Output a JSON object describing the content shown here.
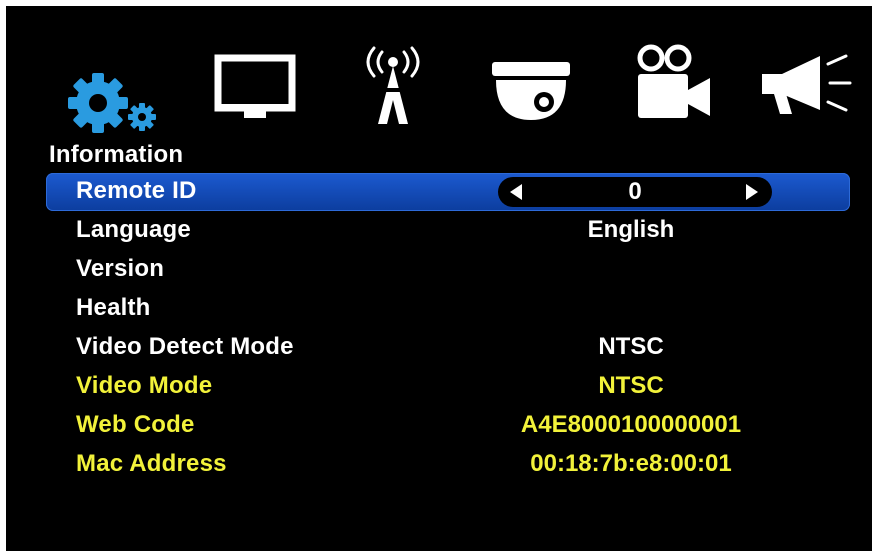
{
  "menu": {
    "icons": [
      {
        "name": "settings-gears-icon",
        "color": "#2a9be0"
      },
      {
        "name": "display-monitor-icon",
        "color": "#ffffff"
      },
      {
        "name": "network-tower-icon",
        "color": "#ffffff"
      },
      {
        "name": "dome-camera-icon",
        "color": "#ffffff"
      },
      {
        "name": "video-record-icon",
        "color": "#ffffff"
      },
      {
        "name": "alarm-megaphone-icon",
        "color": "#ffffff"
      }
    ],
    "section_title": "Information"
  },
  "rows": [
    {
      "label": "Remote ID",
      "value": "0",
      "selected": true
    },
    {
      "label": "Language",
      "value": "English"
    },
    {
      "label": "Version",
      "value": ""
    },
    {
      "label": "Health",
      "value": ""
    },
    {
      "label": "Video Detect Mode",
      "value": "NTSC"
    },
    {
      "label": "Video Mode",
      "value": "NTSC"
    },
    {
      "label": "Web Code",
      "value": "A4E8000100000001"
    },
    {
      "label": "Mac Address",
      "value": "00:18:7b:e8:00:01"
    }
  ],
  "colors": {
    "background": "#000000",
    "selection": "#1c5ad0",
    "text": "#ffffff",
    "readonly_text": "#f2f23a",
    "active_icon": "#2a9be0"
  }
}
